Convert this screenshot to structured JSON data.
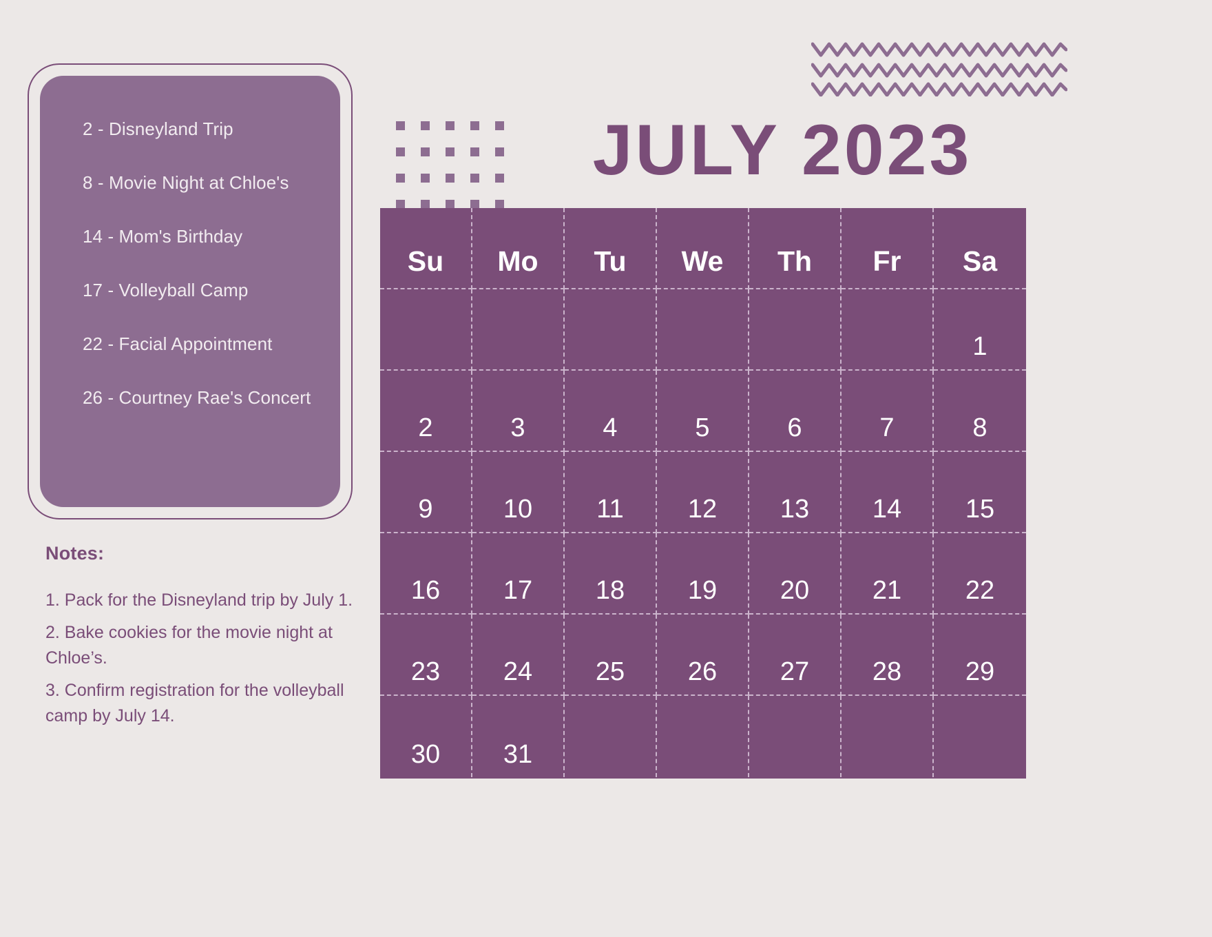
{
  "theme": {
    "background": "#ece8e7",
    "primary_purple": "#7a4d78",
    "card_purple": "#8d6d91",
    "grid_dash": "#cbb4cc",
    "cell_text": "#ffffff"
  },
  "header": {
    "title": "JULY 2023"
  },
  "events_card": {
    "items": [
      "2 - Disneyland Trip",
      "8 - Movie Night at Chloe's",
      "14 - Mom's Birthday",
      "17 - Volleyball Camp",
      "22 - Facial Appointment",
      "26 - Courtney Rae's Concert"
    ]
  },
  "notes": {
    "title": "Notes:",
    "lines": [
      "1. Pack for the Disneyland trip by July 1.",
      "2. Bake cookies for the movie night at Chloe’s.",
      "3. Confirm registration for the volleyball camp by July 14."
    ]
  },
  "decor": {
    "dot_grid": {
      "columns": 5,
      "rows": 4
    },
    "zigzag": {
      "rows": 3
    }
  },
  "calendar": {
    "weekday_headers": [
      "Su",
      "Mo",
      "Tu",
      "We",
      "Th",
      "Fr",
      "Sa"
    ],
    "weeks": [
      [
        "",
        "",
        "",
        "",
        "",
        "",
        "1"
      ],
      [
        "2",
        "3",
        "4",
        "5",
        "6",
        "7",
        "8"
      ],
      [
        "9",
        "10",
        "11",
        "12",
        "13",
        "14",
        "15"
      ],
      [
        "16",
        "17",
        "18",
        "19",
        "20",
        "21",
        "22"
      ],
      [
        "23",
        "24",
        "25",
        "26",
        "27",
        "28",
        "29"
      ],
      [
        "30",
        "31",
        "",
        "",
        "",
        "",
        ""
      ]
    ]
  }
}
